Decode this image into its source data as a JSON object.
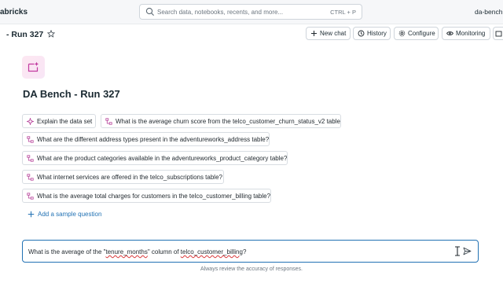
{
  "topbar": {
    "brand": "abricks",
    "search_placeholder": "Search data, notebooks, recents, and more...",
    "search_shortcut": "CTRL + P",
    "workspace": "da-bench"
  },
  "header": {
    "title": "- Run 327",
    "buttons": {
      "new_chat": "New chat",
      "history": "History",
      "configure": "Configure",
      "monitoring": "Monitoring"
    }
  },
  "space": {
    "title": "DA Bench - Run 327"
  },
  "sample_questions": [
    "Explain the data set",
    "What is the average churn score from the telco_customer_churn_status_v2 table?",
    "What are the different address types present in the adventureworks_address table?",
    "What are the product categories available in the adventureworks_product_category table?",
    "What internet services are offered in the telco_subscriptions table?",
    "What is the average total charges for customers in the telco_customer_billing table?"
  ],
  "add_sample": "Add a sample question",
  "input": {
    "value_parts": [
      "What is the average of the \"",
      "tenure_months",
      "\" column of ",
      "telco_customer_billing",
      "?"
    ]
  },
  "disclaimer": "Always review the accuracy of responses.",
  "colors": {
    "accent": "#2272b4",
    "genie_icon": "#c23aa0",
    "chip_icon": "#b6409a"
  }
}
